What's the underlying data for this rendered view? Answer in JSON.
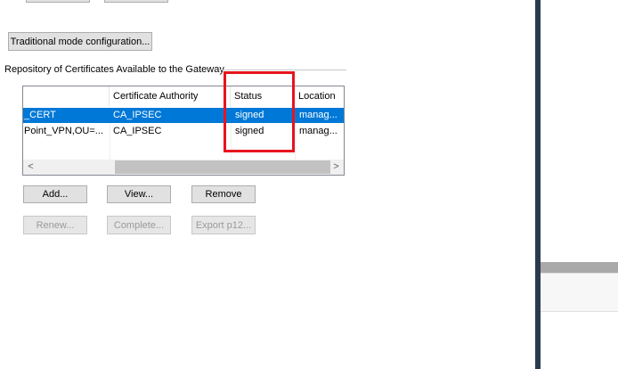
{
  "traditional_mode_button": "Traditional mode configuration...",
  "repository": {
    "label": "Repository of Certificates Available to the Gateway",
    "columns": [
      "",
      "Certificate Authority",
      "Status",
      "Location"
    ],
    "rows": [
      {
        "name": "_CERT",
        "authority": "CA_IPSEC",
        "status": "signed",
        "location": "manag...",
        "selected": true
      },
      {
        "name": "Point_VPN,OU=...",
        "authority": "CA_IPSEC",
        "status": "signed",
        "location": "manag...",
        "selected": false
      }
    ],
    "scroll_left_glyph": "<",
    "scroll_right_glyph": ">"
  },
  "actions": {
    "add": "Add...",
    "view": "View...",
    "remove": "Remove",
    "renew": "Renew...",
    "complete": "Complete...",
    "export": "Export p12..."
  },
  "colors": {
    "selection": "#0078d7",
    "highlight_box": "#e8141e"
  }
}
